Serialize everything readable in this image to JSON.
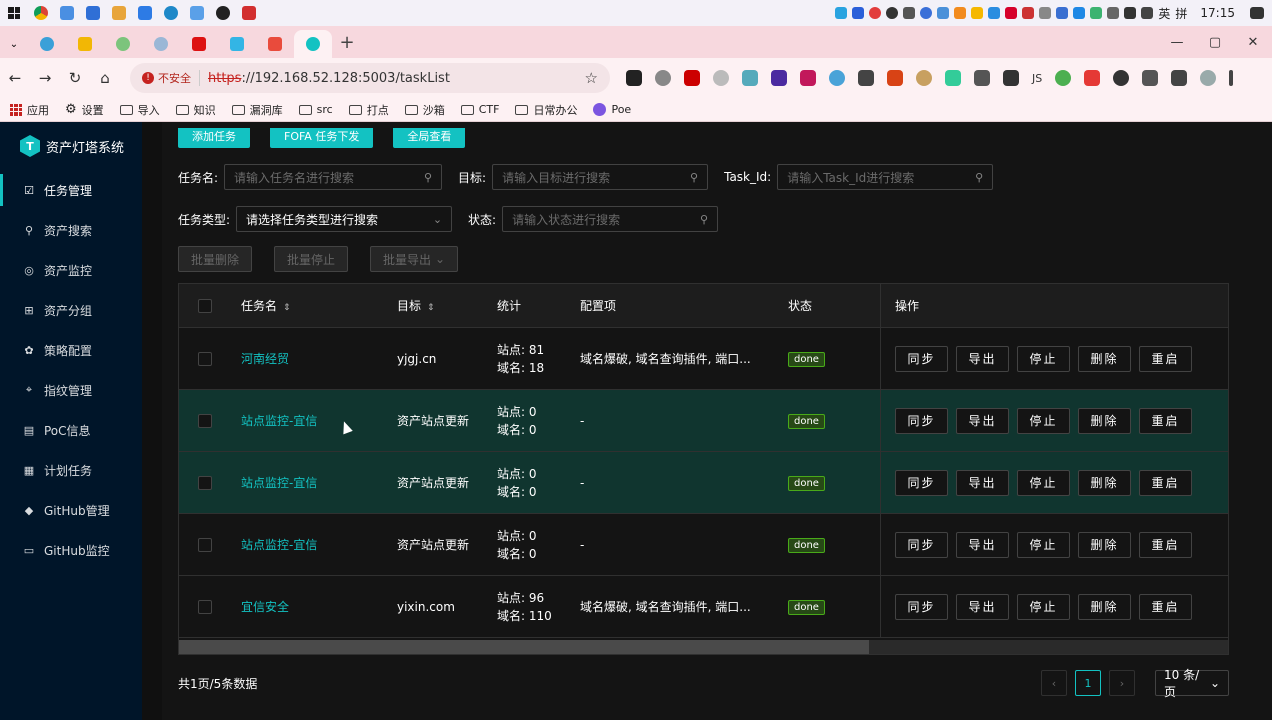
{
  "taskbar": {
    "apps": [
      "chrome-icon",
      "files-icon",
      "app-icon",
      "app-icon",
      "app-icon",
      "app-icon",
      "app-icon",
      "app-icon",
      "app-icon"
    ],
    "ime": "英",
    "ime2": "拼",
    "time": "17:15"
  },
  "browser": {
    "url_scheme": "https",
    "url_rest": "://192.168.52.128:5003/taskList",
    "insecure_label": "不安全",
    "bookmarks": [
      "应用",
      "设置",
      "导入",
      "知识",
      "漏洞库",
      "src",
      "打点",
      "沙箱",
      "CTF",
      "日常办公",
      "Poe"
    ],
    "ext_js": "JS"
  },
  "sidebar": {
    "logo_text": "资产灯塔系统",
    "logo_glyph": "T",
    "items": [
      {
        "label": "任务管理",
        "icon": "task-icon",
        "glyph": "☑"
      },
      {
        "label": "资产搜索",
        "icon": "search-icon",
        "glyph": "⚲"
      },
      {
        "label": "资产监控",
        "icon": "shield-icon",
        "glyph": "◎"
      },
      {
        "label": "资产分组",
        "icon": "cluster-icon",
        "glyph": "⊞"
      },
      {
        "label": "策略配置",
        "icon": "gear-icon",
        "glyph": "✿"
      },
      {
        "label": "指纹管理",
        "icon": "fingerprint-icon",
        "glyph": "⌖"
      },
      {
        "label": "PoC信息",
        "icon": "file-icon",
        "glyph": "▤"
      },
      {
        "label": "计划任务",
        "icon": "schedule-icon",
        "glyph": "▦"
      },
      {
        "label": "GitHub管理",
        "icon": "github-icon",
        "glyph": "◆"
      },
      {
        "label": "GitHub监控",
        "icon": "monitor-icon",
        "glyph": "▭"
      }
    ]
  },
  "actions": {
    "add_task": "添加任务",
    "fofa_task": "FOFA 任务下发",
    "global_view": "全局查看"
  },
  "filters": {
    "task_name_label": "任务名:",
    "task_name_placeholder": "请输入任务名进行搜索",
    "target_label": "目标:",
    "target_placeholder": "请输入目标进行搜索",
    "task_id_label": "Task_Id:",
    "task_id_placeholder": "请输入Task_Id进行搜索",
    "task_type_label": "任务类型:",
    "task_type_value": "请选择任务类型进行搜索",
    "status_label": "状态:",
    "status_placeholder": "请输入状态进行搜索"
  },
  "bulk": {
    "delete": "批量删除",
    "stop": "批量停止",
    "export": "批量导出"
  },
  "table": {
    "headers": {
      "name": "任务名",
      "target": "目标",
      "stats": "统计",
      "config": "配置项",
      "status": "状态",
      "ops": "操作"
    },
    "op_labels": {
      "sync": "同步",
      "export": "导出",
      "stop": "停止",
      "delete": "删除",
      "restart": "重启"
    },
    "rows": [
      {
        "name": "河南经贸",
        "target": "yjgj.cn",
        "site": "站点:  81",
        "domain": "域名:  18",
        "config": "域名爆破, 域名查询插件, 端口...",
        "status": "done"
      },
      {
        "name": "站点监控-宜信",
        "target": "资产站点更新",
        "site": "站点:  0",
        "domain": "域名:  0",
        "config": "-",
        "status": "done"
      },
      {
        "name": "站点监控-宜信",
        "target": "资产站点更新",
        "site": "站点:  0",
        "domain": "域名:  0",
        "config": "-",
        "status": "done"
      },
      {
        "name": "站点监控-宜信",
        "target": "资产站点更新",
        "site": "站点:  0",
        "domain": "域名:  0",
        "config": "-",
        "status": "done"
      },
      {
        "name": "宜信安全",
        "target": "yixin.com",
        "site": "站点:  96",
        "domain": "域名:  110",
        "config": "域名爆破, 域名查询插件, 端口...",
        "status": "done"
      }
    ]
  },
  "pagination": {
    "total_text": "共1页/5条数据",
    "current_page": "1",
    "page_size": "10 条/页"
  },
  "colors": {
    "accent": "#13c2c2",
    "sidebar_bg": "#001529",
    "row_highlight": "#10352f",
    "tag_done": "#49aa19"
  }
}
